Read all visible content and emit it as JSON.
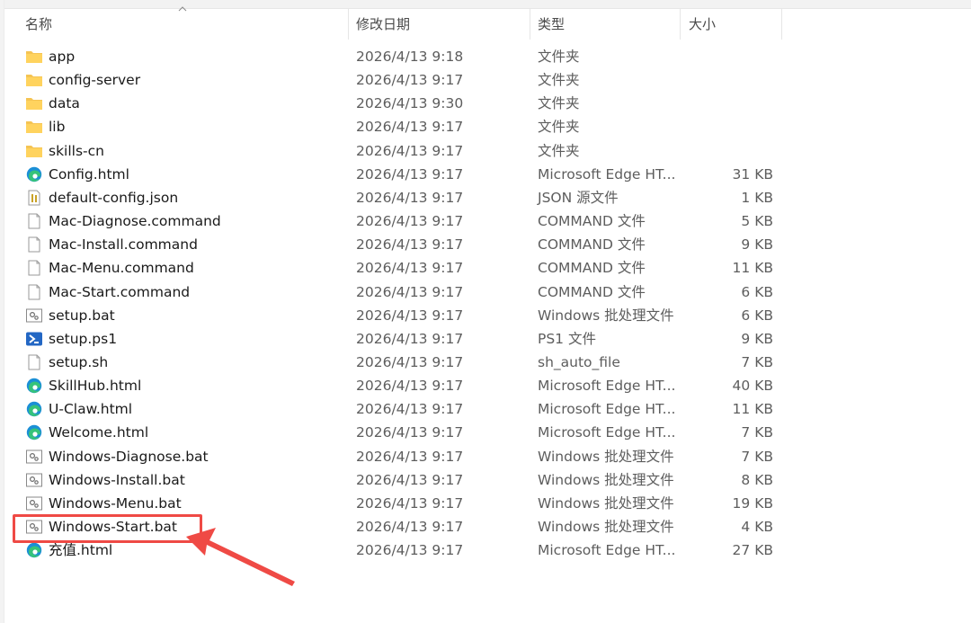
{
  "columns": {
    "name": "名称",
    "date": "修改日期",
    "type": "类型",
    "size": "大小"
  },
  "files": [
    {
      "name": "app",
      "date": "2026/4/13 9:18",
      "type": "文件夹",
      "size": "",
      "icon": "folder-icon"
    },
    {
      "name": "config-server",
      "date": "2026/4/13 9:17",
      "type": "文件夹",
      "size": "",
      "icon": "folder-icon"
    },
    {
      "name": "data",
      "date": "2026/4/13 9:30",
      "type": "文件夹",
      "size": "",
      "icon": "folder-icon"
    },
    {
      "name": "lib",
      "date": "2026/4/13 9:17",
      "type": "文件夹",
      "size": "",
      "icon": "folder-icon"
    },
    {
      "name": "skills-cn",
      "date": "2026/4/13 9:17",
      "type": "文件夹",
      "size": "",
      "icon": "folder-icon"
    },
    {
      "name": "Config.html",
      "date": "2026/4/13 9:17",
      "type": "Microsoft Edge HT...",
      "size": "31 KB",
      "icon": "edge-icon"
    },
    {
      "name": "default-config.json",
      "date": "2026/4/13 9:17",
      "type": "JSON 源文件",
      "size": "1 KB",
      "icon": "json-file-icon"
    },
    {
      "name": "Mac-Diagnose.command",
      "date": "2026/4/13 9:17",
      "type": "COMMAND 文件",
      "size": "5 KB",
      "icon": "blank-file-icon"
    },
    {
      "name": "Mac-Install.command",
      "date": "2026/4/13 9:17",
      "type": "COMMAND 文件",
      "size": "9 KB",
      "icon": "blank-file-icon"
    },
    {
      "name": "Mac-Menu.command",
      "date": "2026/4/13 9:17",
      "type": "COMMAND 文件",
      "size": "11 KB",
      "icon": "blank-file-icon"
    },
    {
      "name": "Mac-Start.command",
      "date": "2026/4/13 9:17",
      "type": "COMMAND 文件",
      "size": "6 KB",
      "icon": "blank-file-icon"
    },
    {
      "name": "setup.bat",
      "date": "2026/4/13 9:17",
      "type": "Windows 批处理文件",
      "size": "6 KB",
      "icon": "batch-file-icon"
    },
    {
      "name": "setup.ps1",
      "date": "2026/4/13 9:17",
      "type": "PS1 文件",
      "size": "9 KB",
      "icon": "powershell-icon"
    },
    {
      "name": "setup.sh",
      "date": "2026/4/13 9:17",
      "type": "sh_auto_file",
      "size": "7 KB",
      "icon": "blank-file-icon"
    },
    {
      "name": "SkillHub.html",
      "date": "2026/4/13 9:17",
      "type": "Microsoft Edge HT...",
      "size": "40 KB",
      "icon": "edge-icon"
    },
    {
      "name": "U-Claw.html",
      "date": "2026/4/13 9:17",
      "type": "Microsoft Edge HT...",
      "size": "11 KB",
      "icon": "edge-icon"
    },
    {
      "name": "Welcome.html",
      "date": "2026/4/13 9:17",
      "type": "Microsoft Edge HT...",
      "size": "7 KB",
      "icon": "edge-icon"
    },
    {
      "name": "Windows-Diagnose.bat",
      "date": "2026/4/13 9:17",
      "type": "Windows 批处理文件",
      "size": "7 KB",
      "icon": "batch-file-icon"
    },
    {
      "name": "Windows-Install.bat",
      "date": "2026/4/13 9:17",
      "type": "Windows 批处理文件",
      "size": "8 KB",
      "icon": "batch-file-icon"
    },
    {
      "name": "Windows-Menu.bat",
      "date": "2026/4/13 9:17",
      "type": "Windows 批处理文件",
      "size": "19 KB",
      "icon": "batch-file-icon"
    },
    {
      "name": "Windows-Start.bat",
      "date": "2026/4/13 9:17",
      "type": "Windows 批处理文件",
      "size": "4 KB",
      "icon": "batch-file-icon"
    },
    {
      "name": "充值.html",
      "date": "2026/4/13 9:17",
      "type": "Microsoft Edge HT...",
      "size": "27 KB",
      "icon": "edge-icon"
    }
  ],
  "annotation": {
    "color": "#ef4a45",
    "highlighted_file": "Windows-Start.bat"
  }
}
